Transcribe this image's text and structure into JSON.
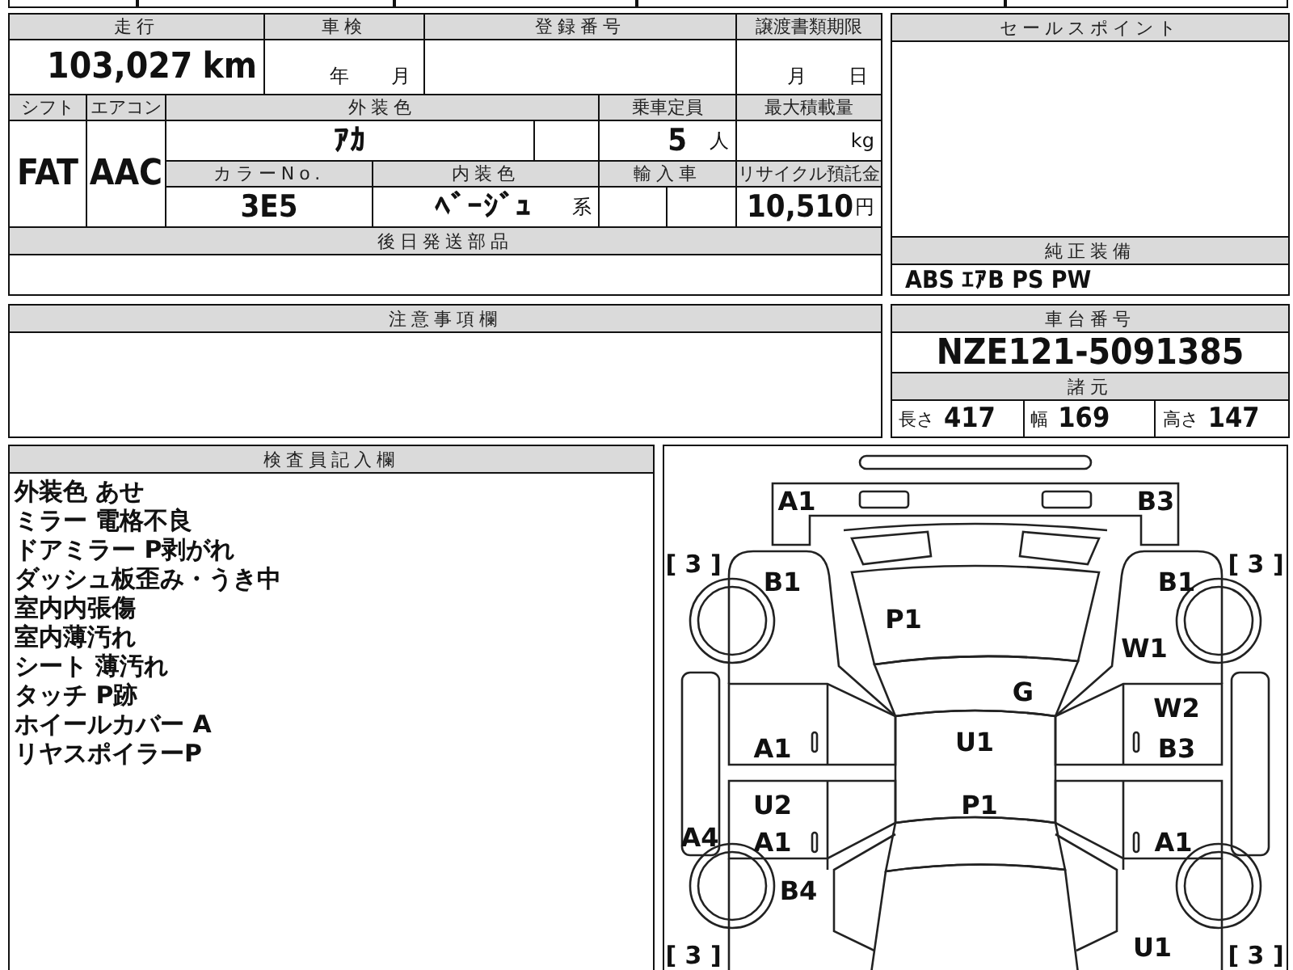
{
  "mileage": {
    "label": "走行",
    "value": "103,027",
    "unit": "km"
  },
  "inspection": {
    "label": "車検",
    "year_unit": "年",
    "month_unit": "月"
  },
  "registration_number": {
    "label": "登録番号"
  },
  "transfer_deadline": {
    "label": "譲渡書類期限",
    "month_unit": "月",
    "day_unit": "日"
  },
  "shift": {
    "label": "シフト",
    "value": "FAT"
  },
  "air_conditioner": {
    "label": "エアコン",
    "value": "AAC"
  },
  "exterior_color": {
    "label": "外装色",
    "value": "ｱｶ"
  },
  "capacity": {
    "label": "乗車定員",
    "value": "5",
    "unit": "人"
  },
  "max_load": {
    "label": "最大積載量",
    "unit": "kg"
  },
  "color_no": {
    "label": "カラーNo.",
    "value": "3E5"
  },
  "interior_color": {
    "label": "内装色",
    "value": "ﾍﾞｰｼﾞｭ",
    "suffix": "系"
  },
  "imported": {
    "label": "輸入車"
  },
  "recycle_deposit": {
    "label": "リサイクル預託金",
    "value": "10,510",
    "unit": "円"
  },
  "parts_sent_later": {
    "label": "後日発送部品"
  },
  "notes": {
    "label": "注意事項欄"
  },
  "sales_points": {
    "label": "セールスポイント"
  },
  "standard_equipment": {
    "label": "純正装備",
    "value": "ABS ｴｱB PS PW"
  },
  "chassis_number": {
    "label": "車台番号",
    "value": "NZE121-5091385"
  },
  "specifications": {
    "label": "諸元",
    "items": [
      {
        "label": "長さ",
        "value": "417"
      },
      {
        "label": "幅",
        "value": "169"
      },
      {
        "label": "高さ",
        "value": "147"
      }
    ]
  },
  "inspector_notes": {
    "label": "検査員記入欄",
    "lines": [
      "外装色 あせ",
      "ミラー 電格不良",
      "ドアミラー P剥がれ",
      "ダッシュ板歪み・うき中",
      "室内内張傷",
      "室内薄汚れ",
      "シート 薄汚れ",
      "タッチ P跡",
      "ホイールカバー A",
      "リヤスポイラーP"
    ]
  },
  "damage_diagram": {
    "tire_marks": [
      {
        "text": "[ 3 ]"
      },
      {
        "text": "[ 3 ]"
      },
      {
        "text": "[ 3 ]"
      },
      {
        "text": "[ 3 ]"
      }
    ],
    "marks": [
      {
        "text": "A1"
      },
      {
        "text": "B3"
      },
      {
        "text": "B1"
      },
      {
        "text": "B1"
      },
      {
        "text": "P1"
      },
      {
        "text": "W1"
      },
      {
        "text": "G"
      },
      {
        "text": "W2"
      },
      {
        "text": "A1"
      },
      {
        "text": "U1"
      },
      {
        "text": "B3"
      },
      {
        "text": "U2"
      },
      {
        "text": "P1"
      },
      {
        "text": "A4"
      },
      {
        "text": "A1"
      },
      {
        "text": "A1"
      },
      {
        "text": "B4"
      },
      {
        "text": "U1"
      }
    ]
  }
}
